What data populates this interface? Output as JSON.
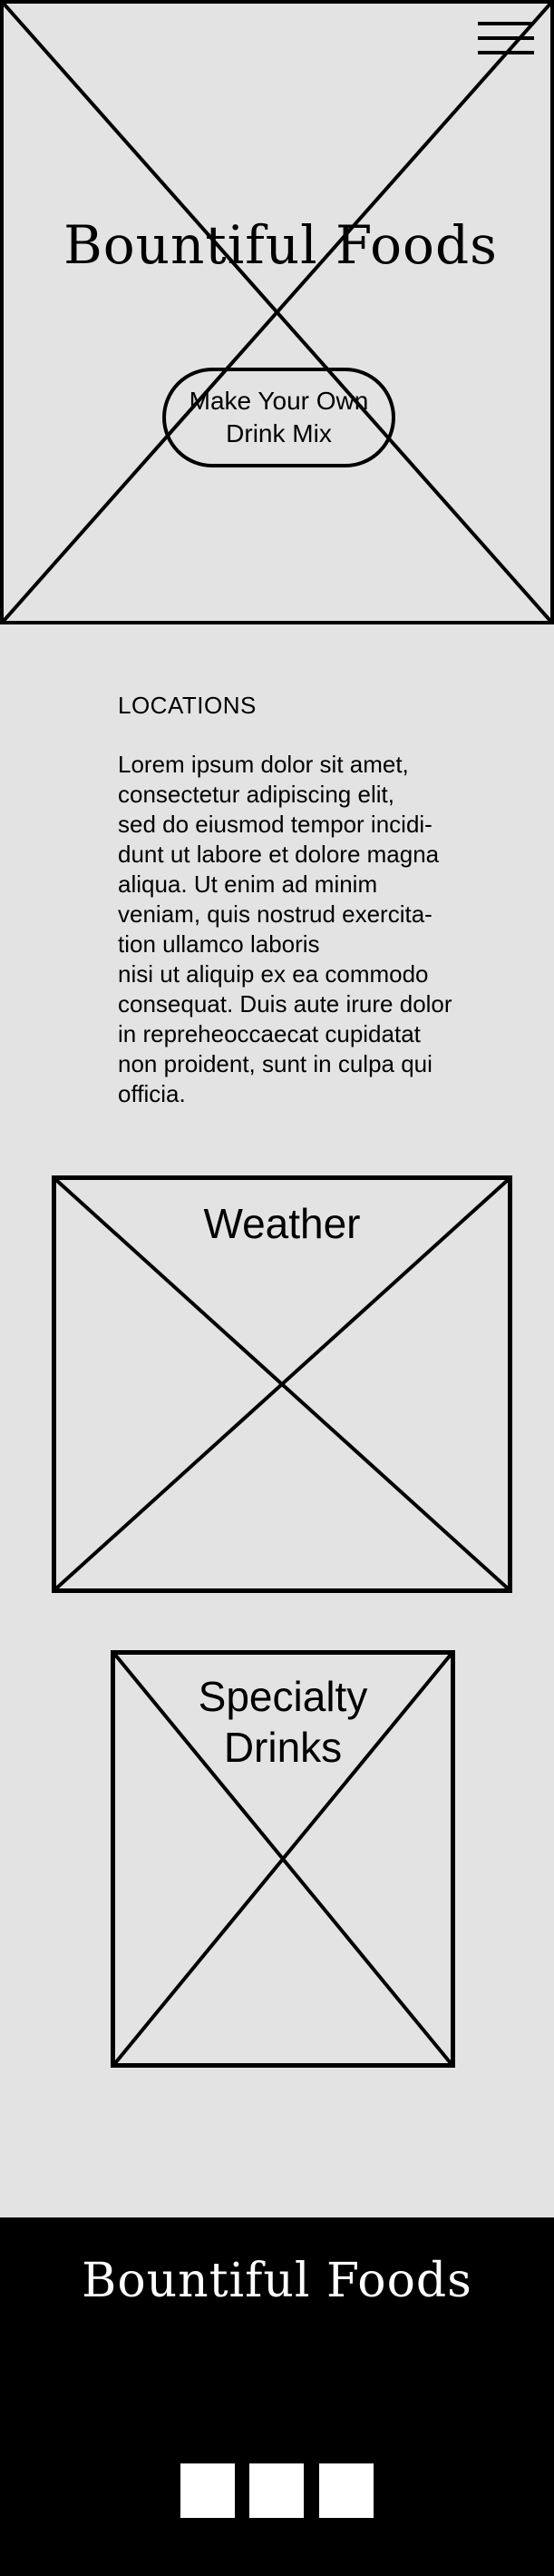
{
  "header": {
    "menu_icon": "hamburger-menu-icon"
  },
  "hero": {
    "title": "Bountiful Foods",
    "cta_label": "Make Your Own Drink Mix",
    "image_placeholder": "image-placeholder-icon"
  },
  "locations": {
    "heading": "LOCATIONS",
    "lines": [
      "Lorem ipsum dolor sit amet,",
      "consectetur adipiscing elit,",
      "sed do eiusmod tempor incidi-",
      "dunt ut labore et dolore magna",
      "aliqua. Ut enim ad minim",
      "veniam, quis nostrud exercita-",
      "tion ullamco laboris",
      "nisi ut aliquip ex ea commodo",
      "consequat. Duis aute irure dolor",
      "in repreheoccaecat cupidatat",
      "non proident, sunt in culpa qui",
      "officia."
    ]
  },
  "weather": {
    "title": "Weather"
  },
  "specialty": {
    "title_line1": "Specialty",
    "title_line2": "Drinks"
  },
  "footer": {
    "title": "Bountiful Foods",
    "social_icons": [
      "social-icon",
      "social-icon",
      "social-icon"
    ]
  },
  "colors": {
    "background": "#e3e3e3",
    "ink": "#000000",
    "footer_background": "#000000",
    "footer_text": "#ffffff"
  }
}
